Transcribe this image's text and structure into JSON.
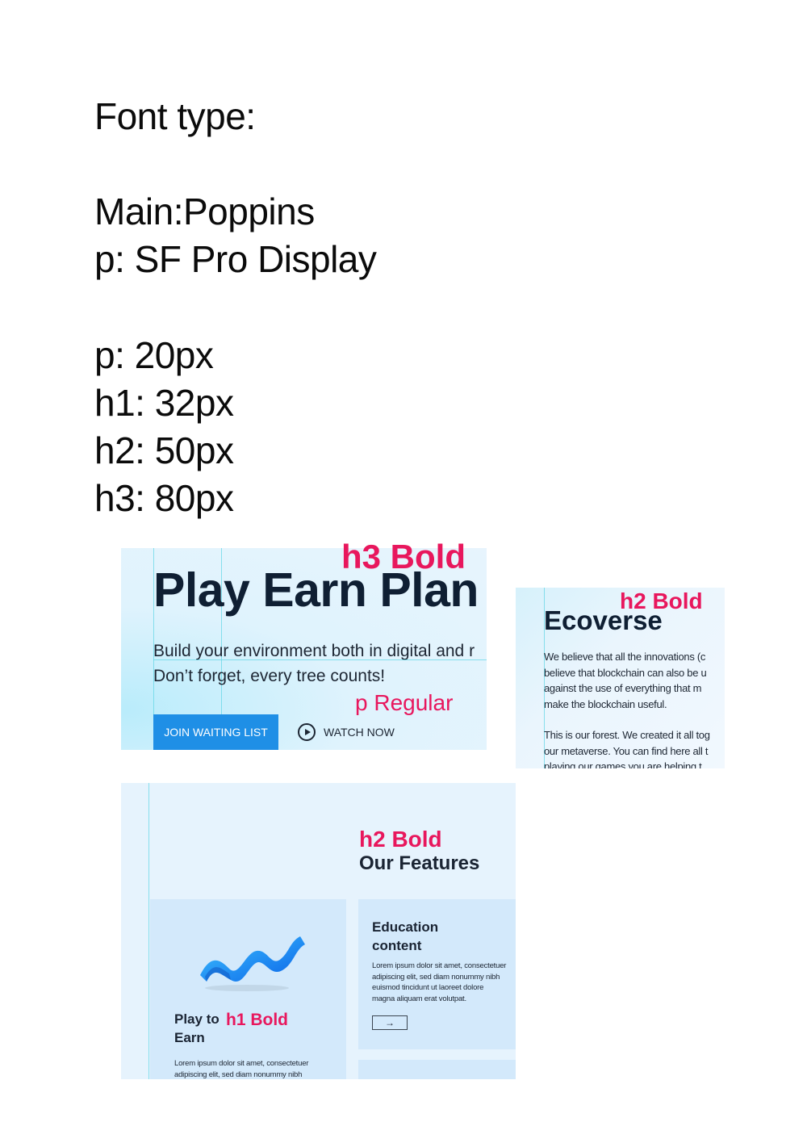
{
  "spec": {
    "heading": "Font type:",
    "main_font": "Main:Poppins",
    "p_font": "p: SF Pro Display",
    "p_size": "p: 20px",
    "h1_size": "h1: 32px",
    "h2_size": "h2: 50px",
    "h3_size": "h3: 80px"
  },
  "hero": {
    "tag": "h3 Bold",
    "title": "Play Earn Plan",
    "line1": "Build your environment both in digital and r",
    "line2": "Don’t forget, every tree counts!",
    "p_tag": "p Regular",
    "join_label": "JOIN WAITING LIST",
    "watch_label": "WATCH NOW"
  },
  "ecoverse": {
    "tag": "h2 Bold",
    "title": "Ecoverse",
    "para1": [
      "We believe that all the innovations (c",
      "believe that blockchain can also be u",
      "against the use of everything that m",
      "make the blockchain useful."
    ],
    "para2": [
      "This is our forest. We created it all tog",
      "our metaverse. You can find here all t",
      "playing our games you are helping t"
    ]
  },
  "features": {
    "tag": "h2 Bold",
    "title": "Our Features",
    "card_left": {
      "title_line1": "Play to",
      "tag": "h1 Bold",
      "title_line2": "Earn",
      "body": [
        "Lorem ipsum dolor sit amet, consectetuer",
        "adipiscing elit, sed diam nonummy nibh"
      ]
    },
    "card_right": {
      "title": [
        "Education",
        "content"
      ],
      "body": [
        "Lorem ipsum dolor sit amet, consectetuer",
        "adipiscing elit, sed diam nonummy nibh",
        "euismod tincidunt ut laoreet dolore",
        "magna aliquam erat volutpat."
      ],
      "arrow": "→"
    }
  },
  "colors": {
    "accent_tag": "#e8175d",
    "button_blue": "#1f8fe6",
    "guide": "#5fd6e6",
    "dark_text": "#0f1f33"
  }
}
